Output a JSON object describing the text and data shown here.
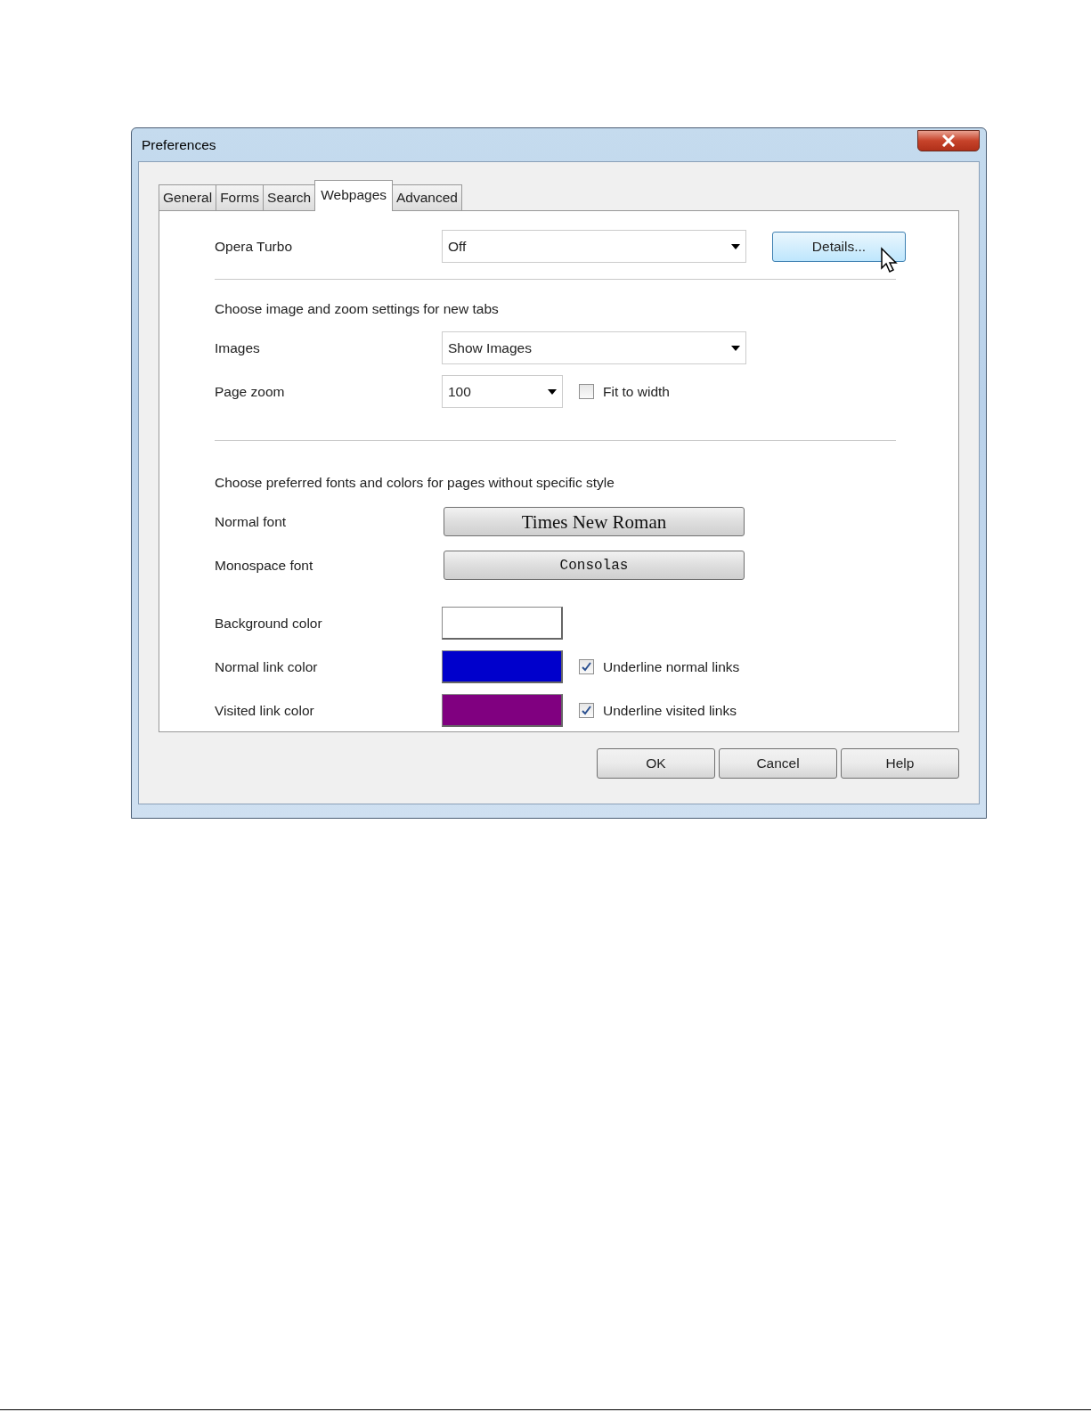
{
  "window": {
    "title": "Preferences"
  },
  "tabs": [
    {
      "label": "General",
      "selected": false
    },
    {
      "label": "Forms",
      "selected": false
    },
    {
      "label": "Search",
      "selected": false
    },
    {
      "label": "Webpages",
      "selected": true
    },
    {
      "label": "Advanced",
      "selected": false
    }
  ],
  "rows": [
    {
      "kind": "select",
      "label": "Opera Turbo",
      "value": "Off",
      "button": "Details..."
    },
    {
      "kind": "divider"
    },
    {
      "kind": "heading",
      "text": "Choose image and zoom settings for new tabs"
    },
    {
      "kind": "select",
      "label": "Images",
      "value": "Show Images"
    },
    {
      "kind": "select",
      "label": "Page zoom",
      "value": "100",
      "checkbox": {
        "label": "Fit to width",
        "checked": false
      }
    },
    {
      "kind": "divider"
    },
    {
      "kind": "heading",
      "text": "Choose preferred fonts and colors for pages without specific style"
    },
    {
      "kind": "serif_font",
      "label": "Normal font",
      "value": "Times New Roman"
    },
    {
      "kind": "mono_font",
      "label": "Monospace font",
      "value": "Consolas"
    },
    {
      "kind": "color",
      "label": "Background color",
      "color": "#ffffff"
    },
    {
      "kind": "color",
      "label": "Normal link color",
      "color": "#0000cc",
      "checkbox": {
        "label": "Underline normal links",
        "checked": true
      }
    },
    {
      "kind": "color",
      "label": "Visited link color",
      "color": "#800080",
      "checkbox": {
        "label": "Underline visited links",
        "checked": true
      }
    }
  ],
  "buttons": [
    "OK",
    "Cancel",
    "Help"
  ]
}
